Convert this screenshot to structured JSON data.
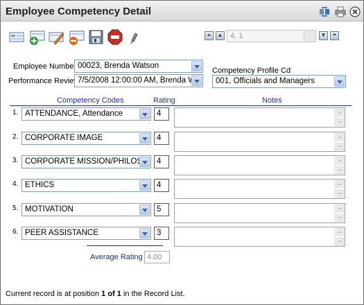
{
  "window": {
    "title": "Employee Competency Detail"
  },
  "toolbar": {
    "icons": [
      "new-record-icon",
      "add-record-icon",
      "edit-record-icon",
      "delete-record-icon",
      "save-icon",
      "stop-icon",
      "pin-icon"
    ]
  },
  "navigator": {
    "record_value": "4, 1"
  },
  "form": {
    "employee_number_label": "Employee Number",
    "employee_number_value": "00023, Brenda Watson",
    "performance_review_label": "Performance Review",
    "performance_review_value": "7/5/2008 12:00:00 AM, Brenda W",
    "competency_profile_label": "Competency Profile Cd",
    "competency_profile_value": "001, Officials and Managers"
  },
  "table": {
    "headers": {
      "codes": "Competency Codes",
      "rating": "Rating",
      "notes": "Notes"
    },
    "rows": [
      {
        "num": "1.",
        "code": "ATTENDANCE, Attendance",
        "rating": "4"
      },
      {
        "num": "2.",
        "code": "CORPORATE IMAGE",
        "rating": "4"
      },
      {
        "num": "3.",
        "code": "CORPORATE MISSION/PHILOSF",
        "rating": "4"
      },
      {
        "num": "4.",
        "code": "ETHICS",
        "rating": "4"
      },
      {
        "num": "5.",
        "code": "MOTIVATION",
        "rating": "5"
      },
      {
        "num": "6.",
        "code": "PEER ASSISTANCE",
        "rating": "3"
      }
    ]
  },
  "average": {
    "label": "Average Rating",
    "value": "4.00"
  },
  "status": {
    "prefix": "Current record is at position ",
    "position": "1 of 1",
    "suffix": " in the Record List."
  },
  "colors": {
    "accent": "#1f2f8f",
    "select_border": "#7f9db9"
  }
}
